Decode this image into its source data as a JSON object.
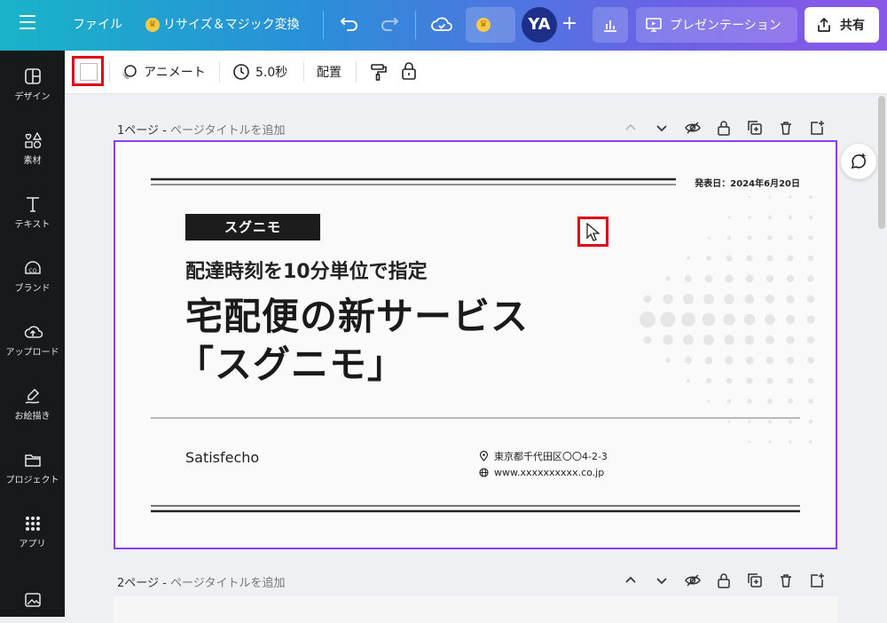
{
  "topbar": {
    "file_label": "ファイル",
    "resize_label": "リサイズ＆マジック変換",
    "avatar_initials": "YA",
    "present_label": "プレゼンテーション",
    "share_label": "共有"
  },
  "sidebar": {
    "items": [
      {
        "label": "デザイン",
        "icon": "design-icon"
      },
      {
        "label": "素材",
        "icon": "elements-icon"
      },
      {
        "label": "テキスト",
        "icon": "text-icon"
      },
      {
        "label": "ブランド",
        "icon": "brand-icon"
      },
      {
        "label": "アップロード",
        "icon": "upload-icon"
      },
      {
        "label": "お絵描き",
        "icon": "draw-icon"
      },
      {
        "label": "プロジェクト",
        "icon": "folder-icon"
      },
      {
        "label": "アプリ",
        "icon": "apps-icon"
      }
    ]
  },
  "context_toolbar": {
    "animate_label": "アニメート",
    "duration_label": "5.0秒",
    "position_label": "配置"
  },
  "pages": [
    {
      "number_label": "1ページ -",
      "title_placeholder": "ページタイトルを追加"
    },
    {
      "number_label": "2ページ -",
      "title_placeholder": "ページタイトルを追加"
    }
  ],
  "slide": {
    "date": "発表日：2024年6月20日",
    "brand_tag": "スグニモ",
    "subhead": "配達時刻を10分単位で指定",
    "headline_line1": "宅配便の新サービス",
    "headline_line2": "「スグニモ」",
    "company": "Satisfecho",
    "address": "東京都千代田区〇〇4-2-3",
    "website": "www.xxxxxxxxxx.co.jp"
  },
  "colors": {
    "accent": "#8b3dff",
    "highlight": "#e0001a",
    "sidebar_bg": "#18191b"
  }
}
